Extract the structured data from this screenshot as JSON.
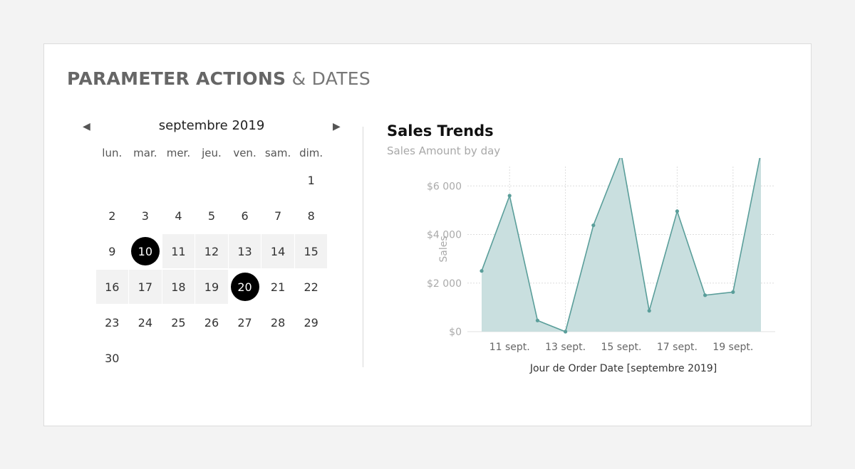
{
  "header": {
    "title_bold": "PARAMETER ACTIONS",
    "title_light": "& DATES"
  },
  "calendar": {
    "month_label": "septembre 2019",
    "prev_icon": "triangle-left-icon",
    "next_icon": "triangle-right-icon",
    "weekdays": [
      "lun.",
      "mar.",
      "mer.",
      "jeu.",
      "ven.",
      "sam.",
      "dim."
    ],
    "days": [
      [
        "",
        "",
        "",
        "",
        "",
        "",
        "1"
      ],
      [
        "2",
        "3",
        "4",
        "5",
        "6",
        "7",
        "8"
      ],
      [
        "9",
        "10",
        "11",
        "12",
        "13",
        "14",
        "15"
      ],
      [
        "16",
        "17",
        "18",
        "19",
        "20",
        "21",
        "22"
      ],
      [
        "23",
        "24",
        "25",
        "26",
        "27",
        "28",
        "29"
      ],
      [
        "30",
        "",
        "",
        "",
        "",
        "",
        ""
      ]
    ],
    "start_day": 10,
    "end_day": 20,
    "colors": {
      "selected": "#000000",
      "range_fill": "#f2f2f2"
    }
  },
  "chart": {
    "title": "Sales Trends",
    "subtitle": "Sales Amount by day"
  },
  "chart_data": {
    "type": "area",
    "xlabel": "Jour de Order Date [septembre 2019]",
    "ylabel": "Sales",
    "x": [
      10,
      11,
      12,
      13,
      14,
      15,
      16,
      17,
      18,
      19,
      20
    ],
    "x_ticks": [
      11,
      13,
      15,
      17,
      19
    ],
    "x_tick_labels": [
      "11 sept.",
      "13 sept.",
      "15 sept.",
      "17 sept.",
      "19 sept."
    ],
    "y_ticks": [
      0,
      2000,
      4000,
      6000
    ],
    "y_tick_labels": [
      "$0",
      "$2 000",
      "$4 000",
      "$6 000"
    ],
    "ylim": [
      0,
      6800
    ],
    "series": [
      {
        "values": [
          2500,
          5600,
          460,
          0,
          4380,
          7300,
          860,
          4960,
          1500,
          1630,
          7400
        ]
      }
    ],
    "colors": {
      "line": "#5a9e9a",
      "fill": "#c9dfdf",
      "grid": "#dddddd"
    },
    "grid": true
  }
}
